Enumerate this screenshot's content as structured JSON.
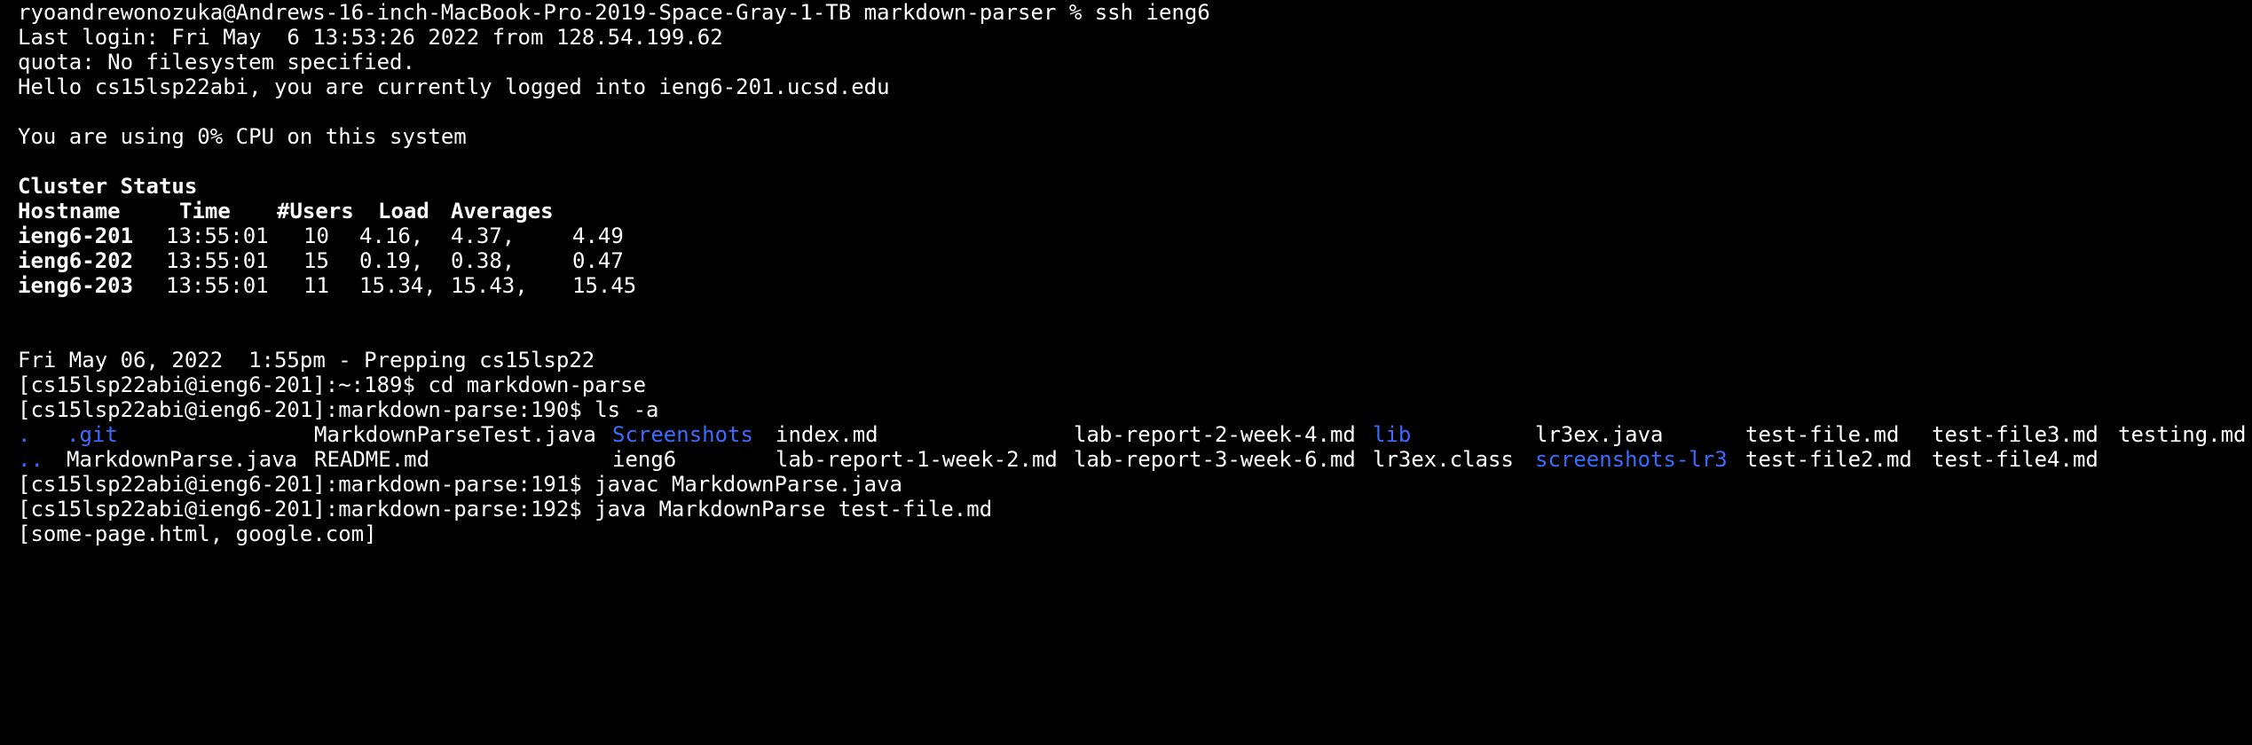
{
  "theme": {
    "background": "#000000",
    "foreground": "#ffffff",
    "directory_color": "#3b6bff"
  },
  "terminal": {
    "ssh_prompt": "ryoandrewonozuka@Andrews-16-inch-MacBook-Pro-2019-Space-Gray-1-TB markdown-parser % ssh ieng6",
    "last_login": "Last login: Fri May  6 13:53:26 2022 from 128.54.199.62",
    "quota": "quota: No filesystem specified.",
    "hello": "Hello cs15lsp22abi, you are currently logged into ieng6-201.ucsd.edu",
    "cpu": "You are using 0% CPU on this system",
    "cluster_title": "Cluster Status",
    "cluster_headers": [
      "Hostname",
      "Time",
      "#Users",
      "Load",
      "Averages"
    ],
    "cluster_rows": [
      {
        "host": "ieng6-201",
        "time": "13:55:01",
        "users": "10",
        "load1": "4.16,",
        "load2": "4.37,",
        "load3": "4.49"
      },
      {
        "host": "ieng6-202",
        "time": "13:55:01",
        "users": "15",
        "load1": "0.19,",
        "load2": "0.38,",
        "load3": "0.47"
      },
      {
        "host": "ieng6-203",
        "time": "13:55:01",
        "users": "11",
        "load1": "15.34,",
        "load2": "15.43,",
        "load3": "15.45"
      }
    ],
    "banner": "Fri May 06, 2022  1:55pm - Prepping cs15lsp22",
    "cmd_cd": "[cs15lsp22abi@ieng6-201]:~:189$ cd markdown-parse",
    "cmd_ls": "[cs15lsp22abi@ieng6-201]:markdown-parse:190$ ls -a",
    "ls_row1": [
      {
        "name": ".",
        "dir": true
      },
      {
        "name": ".git",
        "dir": true
      },
      {
        "name": "MarkdownParseTest.java",
        "dir": false
      },
      {
        "name": "Screenshots",
        "dir": true
      },
      {
        "name": "index.md",
        "dir": false
      },
      {
        "name": "lab-report-2-week-4.md",
        "dir": false
      },
      {
        "name": "lib",
        "dir": true
      },
      {
        "name": "lr3ex.java",
        "dir": false
      },
      {
        "name": "test-file.md",
        "dir": false
      },
      {
        "name": "test-file3.md",
        "dir": false
      },
      {
        "name": "testing.md",
        "dir": false
      }
    ],
    "ls_row2": [
      {
        "name": "..",
        "dir": true
      },
      {
        "name": "MarkdownParse.java",
        "dir": false
      },
      {
        "name": "README.md",
        "dir": false
      },
      {
        "name": "ieng6",
        "dir": false
      },
      {
        "name": "lab-report-1-week-2.md",
        "dir": false
      },
      {
        "name": "lab-report-3-week-6.md",
        "dir": false
      },
      {
        "name": "lr3ex.class",
        "dir": false
      },
      {
        "name": "screenshots-lr3",
        "dir": true
      },
      {
        "name": "test-file2.md",
        "dir": false
      },
      {
        "name": "test-file4.md",
        "dir": false
      }
    ],
    "cmd_javac": "[cs15lsp22abi@ieng6-201]:markdown-parse:191$ javac MarkdownParse.java",
    "cmd_java": "[cs15lsp22abi@ieng6-201]:markdown-parse:192$ java MarkdownParse test-file.md",
    "output": "[some-page.html, google.com]"
  }
}
